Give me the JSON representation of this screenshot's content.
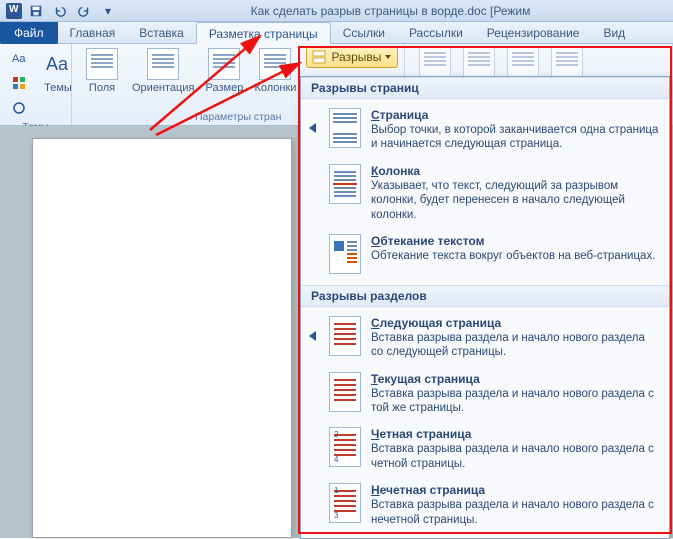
{
  "title": "Как сделать разрыв страницы в ворде.doc [Режим",
  "tabs": {
    "file": "Файл",
    "home": "Главная",
    "insert": "Вставка",
    "layout": "Разметка страницы",
    "references": "Ссылки",
    "mailings": "Рассылки",
    "review": "Рецензирование",
    "view": "Вид"
  },
  "ribbon": {
    "group_themes": "Темы",
    "themes_btn": "Темы",
    "group_page": "Параметры стран",
    "fields": "Поля",
    "orientation": "Ориентация",
    "size": "Размер",
    "columns": "Колонки",
    "breaks": "Разрывы"
  },
  "dropdown": {
    "section1": "Разрывы страниц",
    "items1": [
      {
        "title": "Страница",
        "hot": "С",
        "desc": "Выбор точки, в которой заканчивается одна страница и начинается следующая страница."
      },
      {
        "title": "Колонка",
        "hot": "К",
        "desc": "Указывает, что текст, следующий за разрывом колонки, будет перенесен в начало следующей колонки."
      },
      {
        "title": "Обтекание текстом",
        "hot": "О",
        "desc": "Обтекание текста вокруг объектов на веб-страницах."
      }
    ],
    "section2": "Разрывы разделов",
    "items2": [
      {
        "title": "Следующая страница",
        "hot": "С",
        "desc": "Вставка разрыва раздела и начало нового раздела со следующей страницы."
      },
      {
        "title": "Текущая страница",
        "hot": "Т",
        "desc": "Вставка разрыва раздела и начало нового раздела с той же страницы."
      },
      {
        "title": "Четная страница",
        "hot": "Ч",
        "desc": "Вставка разрыва раздела и начало нового раздела с четной страницы."
      },
      {
        "title": "Нечетная страница",
        "hot": "Н",
        "desc": "Вставка разрыва раздела и начало нового раздела с нечетной страницы."
      }
    ]
  }
}
